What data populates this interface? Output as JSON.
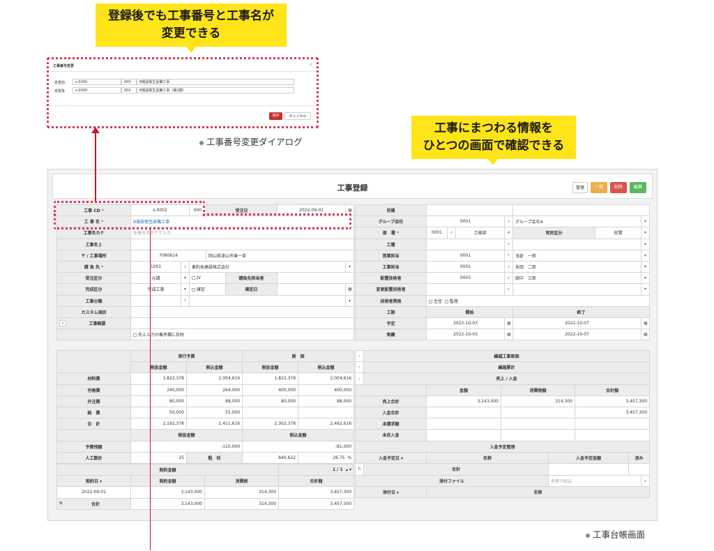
{
  "callouts": {
    "top_left": [
      "登録後でも工事番号と工事名が",
      "変更できる"
    ],
    "top_right": [
      "工事にまつわる情報を",
      "ひとつの画面で確認できる"
    ]
  },
  "captions": {
    "dialog": "工事番号変更ダイアログ",
    "main": "工事台帳画面"
  },
  "dialog": {
    "title": "工事番号変更",
    "close": "×",
    "rows": [
      {
        "label": "変更前",
        "code": "s-0000",
        "num": "000",
        "name": "B施設衛生設備工事"
      },
      {
        "label": "変更後",
        "code": "s-0000",
        "num": "000",
        "name": "B施設衛生設備工事（第2期）"
      }
    ],
    "save": "保存",
    "cancel": "キャンセル"
  },
  "header": {
    "title": "工事登録",
    "buttons": {
      "manage": "管理",
      "list": "一覧",
      "delete": "削除",
      "edit": "編集"
    }
  },
  "left": {
    "kouji_cd": {
      "label": "工事 CD",
      "value": "s-0002",
      "num": "000",
      "date_label": "受注日",
      "date": "2022-09-01"
    },
    "kouji_name": {
      "label": "工 事 名",
      "value": "B施設衛生設備工事"
    },
    "kana": {
      "label": "工事名カナ",
      "placeholder": "全角カタカナで入力"
    },
    "name2": {
      "label": "工事名２"
    },
    "address": {
      "label": "〒 / 工事場所",
      "zip": "7080814",
      "addr": "岡山県津山市東一宮"
    },
    "client": {
      "label": "請 負 先",
      "code": "1001",
      "name": "東利本建設株式会社"
    },
    "order_type": {
      "label": "受注区分",
      "value": "元請",
      "jv": "JV",
      "person": "請負先担当者"
    },
    "complete_type": {
      "label": "完成区分",
      "value": "完成工事",
      "fixed": "確定",
      "fixed_date": "確定日"
    },
    "category": {
      "label": "工事分類"
    },
    "custom": {
      "label": "カスタム項目"
    },
    "summary": {
      "label": "工事概要"
    },
    "reflect": "売上入力の備考欄に反映",
    "budget": {
      "exec": "実行予算",
      "cost": "原　価",
      "tax_ex": "税抜金額",
      "tax_in": "税込金額"
    },
    "budget_rows": [
      {
        "label": "材料費",
        "v1": "1,822,378",
        "v2": "2,004,616",
        "v3": "1,822,378",
        "v4": "2,004,616"
      },
      {
        "label": "労務費",
        "v1": "240,000",
        "v2": "264,000",
        "v3": "400,000",
        "v4": "400,000"
      },
      {
        "label": "外注費",
        "v1": "80,000",
        "v2": "88,000",
        "v3": "80,000",
        "v4": "88,000"
      },
      {
        "label": "経　費",
        "v1": "50,000",
        "v2": "55,000",
        "v3": "",
        "v4": ""
      },
      {
        "label": "合　計",
        "v1": "2,192,378",
        "v2": "2,411,616",
        "v3": "2,302,378",
        "v4": "2,492,616"
      }
    ],
    "remain": {
      "label": "予算残額",
      "v1": "-110,000",
      "v2": "-81,000"
    },
    "labor": {
      "label": "人工数計",
      "v1": "25",
      "profit_label": "粗　利",
      "profit": "840,622",
      "rate": "26.75",
      "pct": "%"
    },
    "contract": {
      "title": "契約金額",
      "page": "1 / 1",
      "date_h": "契約日 ▾",
      "amount_h": "契約金額",
      "tax_h": "消費税",
      "total_h": "合計額",
      "date": "2022-09-01",
      "amount": "3,143,000",
      "tax": "314,300",
      "total": "3,457,300",
      "sum_label": "合計",
      "sum_amount": "3,143,000",
      "sum_tax": "314,300",
      "sum_total": "3,457,300"
    }
  },
  "right": {
    "estimate": {
      "label": "見積"
    },
    "group": {
      "label": "グループ会社",
      "code": "0001",
      "name": "グループ会社A"
    },
    "dept": {
      "label": "部　署",
      "code": "0001",
      "name": "工務部",
      "kanri": "官民区分",
      "kanri_val": "民間"
    },
    "type": {
      "label": "工種"
    },
    "sales": {
      "label": "営業担当",
      "code": "0001",
      "name": "浅倉　一郎"
    },
    "work": {
      "label": "工事担当",
      "code": "0002",
      "name": "永田　二郎"
    },
    "engineer": {
      "label": "配置技術者",
      "code": "0003",
      "name": "田中　三郎"
    },
    "change": {
      "label": "変更配置技術者"
    },
    "qual": {
      "label": "技術者資格",
      "opt1": "主任",
      "opt2": "監理"
    },
    "period": {
      "label": "工期",
      "start": "開始",
      "end": "終了",
      "plan": "予定",
      "actual": "実績",
      "plan_start": "2022-10-03",
      "plan_end": "2022-10-07",
      "act_start": "2022-10-03",
      "act_end": "2022-10-07"
    },
    "sections": {
      "s1": "繰越工事原価",
      "s2": "繰越累計",
      "s3": "売上 / 入金"
    },
    "sales_head": {
      "amount": "金額",
      "tax": "消費税額",
      "total": "合計額"
    },
    "sales_rows": [
      {
        "label": "売上合計",
        "amount": "3,143,000",
        "tax": "314,300",
        "total": "3,457,300"
      },
      {
        "label": "入金合計",
        "amount": "",
        "tax": "",
        "total": "3,457,300"
      },
      {
        "label": "未請求額",
        "amount": "",
        "tax": "",
        "total": ""
      },
      {
        "label": "未収入金",
        "amount": "",
        "tax": "",
        "total": ""
      }
    ],
    "plan_mgmt": {
      "title": "入金予定管理",
      "date_h": "入金予定日 ▾",
      "name_h": "名称",
      "amount_h": "入金予定金額",
      "done_h": "済み",
      "total": "合計"
    },
    "attach": {
      "title": "添付ファイル",
      "placeholder": "名称で絞込",
      "date_h": "添付日 ▾",
      "name_h": "名称"
    }
  },
  "colors": {
    "accent": "#d83a52",
    "callout": "#ffe419",
    "list_btn": "#f0ad4e",
    "delete_btn": "#d9534f",
    "edit_btn": "#5cb85c"
  }
}
